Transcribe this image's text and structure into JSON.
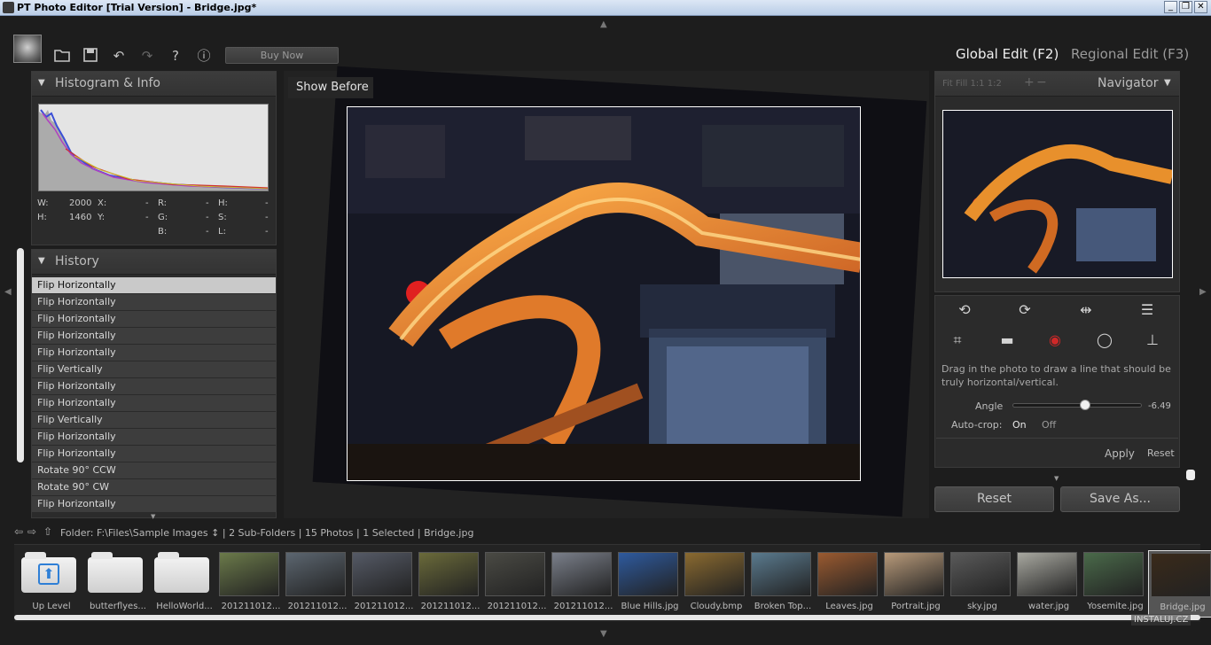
{
  "window": {
    "title": "PT Photo Editor [Trial Version] - Bridge.jpg*"
  },
  "toolbar": {
    "buy_now": "Buy Now",
    "global_edit": "Global Edit (F2)",
    "regional_edit": "Regional Edit (F3)"
  },
  "histogram_panel": {
    "title": "Histogram & Info",
    "info": [
      {
        "key": "W:",
        "val": "2000"
      },
      {
        "key": "X:",
        "val": "-"
      },
      {
        "key": "R:",
        "val": "-"
      },
      {
        "key": "H:",
        "val": "-"
      },
      {
        "key": "H:",
        "val": "1460"
      },
      {
        "key": "Y:",
        "val": "-"
      },
      {
        "key": "G:",
        "val": "-"
      },
      {
        "key": "S:",
        "val": "-"
      },
      {
        "key": "B:",
        "val": "-"
      },
      {
        "key": "L:",
        "val": "-"
      }
    ]
  },
  "history_panel": {
    "title": "History",
    "items": [
      "Flip Horizontally",
      "Flip Horizontally",
      "Flip Horizontally",
      "Flip Horizontally",
      "Flip Horizontally",
      "Flip Vertically",
      "Flip Horizontally",
      "Flip Horizontally",
      "Flip Vertically",
      "Flip Horizontally",
      "Flip Horizontally",
      "Rotate 90° CCW",
      "Rotate 90° CW",
      "Flip Horizontally"
    ]
  },
  "canvas": {
    "show_before": "Show Before"
  },
  "navigator": {
    "zoom_controls": "Fit  Fill  1:1  1:2",
    "title": "Navigator"
  },
  "straighten": {
    "instructions": "Drag in the photo to draw a line that should be truly horizontal/vertical.",
    "angle_label": "Angle",
    "angle_value": "-6.49",
    "angle_fraction": 0.56,
    "autocrop_label": "Auto-crop:",
    "autocrop_on": "On",
    "autocrop_off": "Off",
    "apply": "Apply",
    "reset": "Reset"
  },
  "footer_buttons": {
    "reset": "Reset",
    "save_as": "Save As..."
  },
  "folder_bar": {
    "text": "Folder:  F:\\Files\\Sample Images ↕ | 2 Sub-Folders | 15 Photos | 1 Selected | Bridge.jpg"
  },
  "filmstrip": [
    {
      "label": "Up Level",
      "kind": "up"
    },
    {
      "label": "butterflyes...",
      "kind": "folder"
    },
    {
      "label": "HelloWorld...",
      "kind": "folder"
    },
    {
      "label": "201211012...",
      "kind": "photo",
      "color": "#6b7a4a"
    },
    {
      "label": "201211012...",
      "kind": "photo",
      "color": "#5c6670"
    },
    {
      "label": "201211012...",
      "kind": "photo",
      "color": "#555a66"
    },
    {
      "label": "201211012...",
      "kind": "photo",
      "color": "#6a6a3a"
    },
    {
      "label": "201211012...",
      "kind": "photo",
      "color": "#4a4a44"
    },
    {
      "label": "201211012...",
      "kind": "photo",
      "color": "#7a7f8a"
    },
    {
      "label": "Blue Hills.jpg",
      "kind": "photo",
      "color": "#2e5a9e"
    },
    {
      "label": "Cloudy.bmp",
      "kind": "photo",
      "color": "#8a6a30"
    },
    {
      "label": "Broken Top...",
      "kind": "photo",
      "color": "#5a7a8e"
    },
    {
      "label": "Leaves.jpg",
      "kind": "photo",
      "color": "#9a5a30"
    },
    {
      "label": "Portrait.jpg",
      "kind": "photo",
      "color": "#b89a7a"
    },
    {
      "label": "sky.jpg",
      "kind": "photo",
      "color": "#5a5a5a"
    },
    {
      "label": "water.jpg",
      "kind": "photo",
      "color": "#a8a8a0"
    },
    {
      "label": "Yosemite.jpg",
      "kind": "photo",
      "color": "#4a6a4a"
    },
    {
      "label": "Bridge.jpg",
      "kind": "photo",
      "color": "#3a2a1a",
      "selected": true
    }
  ],
  "watermark": "INSTALUJ.CZ"
}
